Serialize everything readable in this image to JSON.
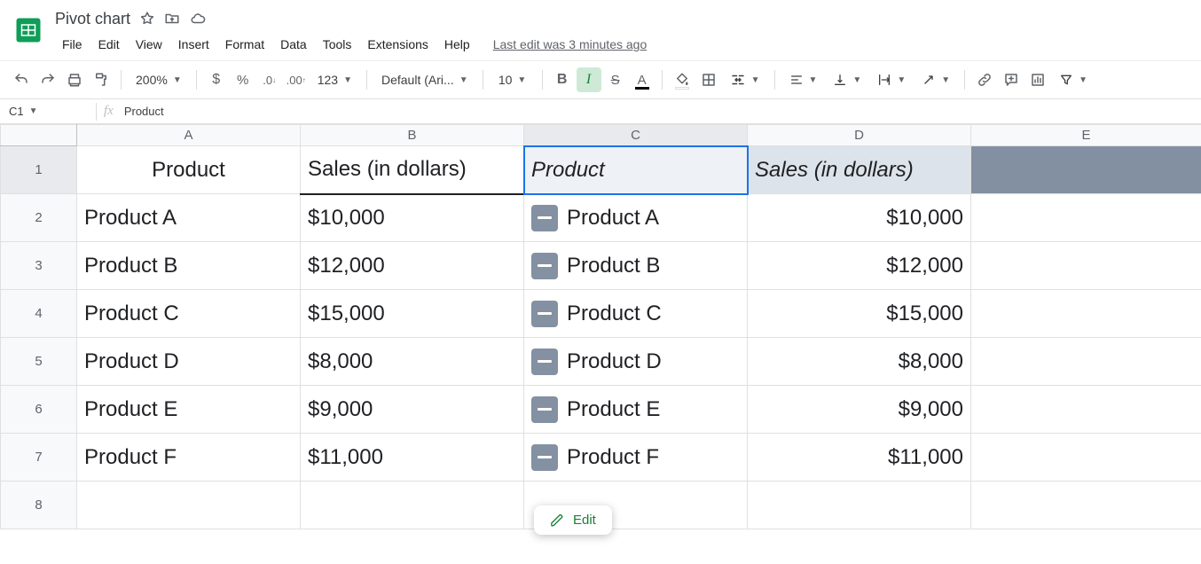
{
  "doc": {
    "title": "Pivot chart"
  },
  "menus": {
    "file": "File",
    "edit": "Edit",
    "view": "View",
    "insert": "Insert",
    "format": "Format",
    "data": "Data",
    "tools": "Tools",
    "extensions": "Extensions",
    "help": "Help",
    "lastEdit": "Last edit was 3 minutes ago"
  },
  "toolbar": {
    "zoom": "200%",
    "font": "Default (Ari...",
    "fontSize": "10",
    "moreFormats": "123"
  },
  "nameBox": {
    "ref": "C1",
    "value": "Product"
  },
  "columns": {
    "A": "A",
    "B": "B",
    "C": "C",
    "D": "D",
    "E": "E"
  },
  "rows": [
    "1",
    "2",
    "3",
    "4",
    "5",
    "6",
    "7",
    "8"
  ],
  "headers": {
    "A1": "Product",
    "B1": "Sales (in dollars)",
    "C1": "Product",
    "D1": "Sales (in dollars)"
  },
  "data": [
    {
      "a": "Product A",
      "b": "$10,000",
      "c": "Product A",
      "d": "$10,000"
    },
    {
      "a": "Product B",
      "b": "$12,000",
      "c": "Product B",
      "d": "$12,000"
    },
    {
      "a": "Product C",
      "b": "$15,000",
      "c": "Product C",
      "d": "$15,000"
    },
    {
      "a": "Product D",
      "b": "$8,000",
      "c": "Product D",
      "d": "$8,000"
    },
    {
      "a": "Product E",
      "b": "$9,000",
      "c": "Product E",
      "d": "$9,000"
    },
    {
      "a": "Product F",
      "b": "$11,000",
      "c": "Product F",
      "d": "$11,000"
    }
  ],
  "editPopup": {
    "label": "Edit"
  }
}
